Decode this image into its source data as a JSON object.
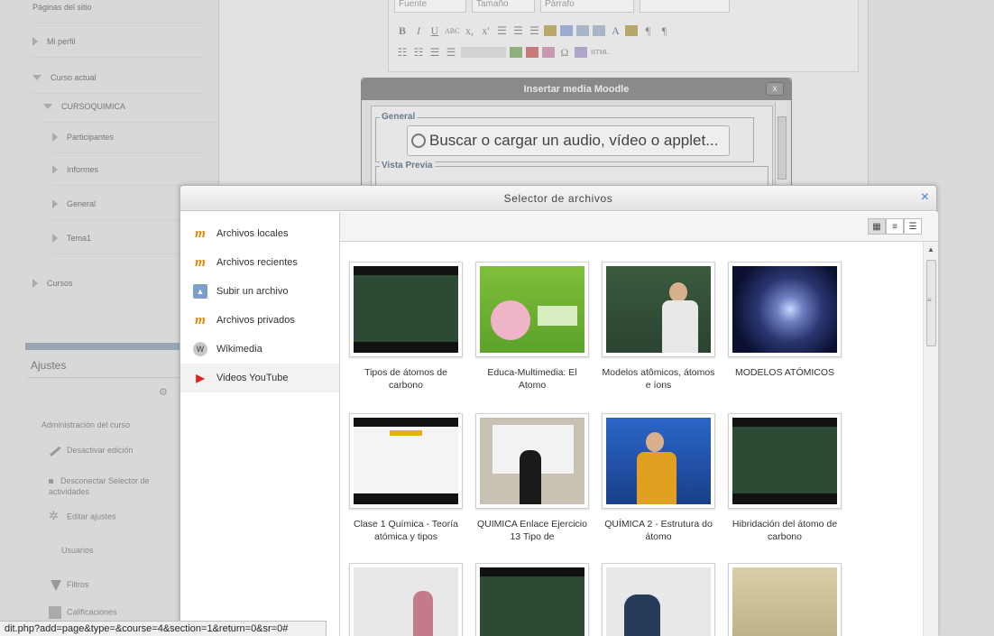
{
  "background": {
    "nav_items": [
      {
        "label": "Páginas del sitio",
        "level": 1
      },
      {
        "label": "Mi perfil",
        "level": 1
      },
      {
        "label": "Curso actual",
        "level": 1
      },
      {
        "label": "CURSOQUIMICA",
        "level": 2
      },
      {
        "label": "Participantes",
        "level": 3
      },
      {
        "label": "Informes",
        "level": 3
      },
      {
        "label": "General",
        "level": 3
      },
      {
        "label": "Tema1",
        "level": 3
      },
      {
        "label": "Cursos",
        "level": 1
      }
    ],
    "ajustes_title": "Ajustes",
    "settings_items": [
      "Administración del curso",
      "Desactivar edición",
      "Desconectar Selector de actividades",
      "Editar ajustes",
      "Usuarios",
      "Filtros",
      "Calificaciones"
    ],
    "toolbar": {
      "font_label": "Fuente",
      "size_label": "Tamaño",
      "para_label": "Párrafo"
    },
    "media_dialog": {
      "title": "Insertar media Moodle",
      "close": "x",
      "general_legend": "General",
      "buscar_label": "Buscar o cargar un audio, vídeo o applet...",
      "preview_legend": "Vista Previa"
    }
  },
  "picker": {
    "title": "Selector de archivos",
    "close_icon": "×",
    "repositories": [
      {
        "label": "Archivos locales",
        "icon": "moodle-icon"
      },
      {
        "label": "Archivos recientes",
        "icon": "moodle-icon"
      },
      {
        "label": "Subir un archivo",
        "icon": "upload-icon"
      },
      {
        "label": "Archivos privados",
        "icon": "moodle-icon"
      },
      {
        "label": "Wikimedia",
        "icon": "wikimedia-icon"
      },
      {
        "label": "Videos YouTube",
        "icon": "youtube-icon",
        "selected": true
      }
    ],
    "view_buttons": [
      "icon-view",
      "list-view",
      "tree-view"
    ],
    "items": [
      {
        "label": "Tipos de átomos de carbono",
        "thumb": "chalk"
      },
      {
        "label": "Educa-Multimedia: El Atomo",
        "thumb": "green"
      },
      {
        "label": "Modelos atômicos, átomos e íons",
        "thumb": "person"
      },
      {
        "label": "MODELOS ATÓMICOS",
        "thumb": "atom"
      },
      {
        "label": "Clase 1 Química - Teoría atómica y tipos",
        "thumb": "slide"
      },
      {
        "label": "QUIMICA Enlace Ejercicio 13 Tipo de",
        "thumb": "board"
      },
      {
        "label": "QUÍMICA 2 - Estrutura do átomo",
        "thumb": "stage"
      },
      {
        "label": "Hibridación del átomo de carbono",
        "thumb": "chalk"
      },
      {
        "label": "",
        "thumb": "white"
      },
      {
        "label": "",
        "thumb": "chalk"
      },
      {
        "label": "",
        "thumb": "white"
      },
      {
        "label": "",
        "thumb": "class"
      }
    ]
  },
  "status_url": "dit.php?add=page&type=&course=4&section=1&return=0&sr=0#"
}
